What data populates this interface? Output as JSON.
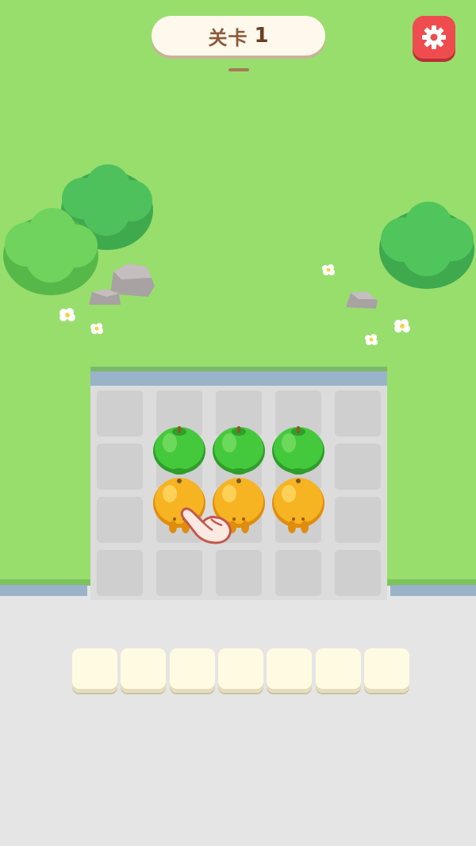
{
  "header": {
    "level_label": "关卡",
    "level_number": "1",
    "settings_icon": "gear-icon"
  },
  "board": {
    "columns": 5,
    "rows": 4,
    "pieces": [
      {
        "type": "green-apple",
        "col": 1,
        "row": 0
      },
      {
        "type": "green-apple",
        "col": 2,
        "row": 0
      },
      {
        "type": "green-apple",
        "col": 3,
        "row": 0
      },
      {
        "type": "orange",
        "col": 1,
        "row": 1
      },
      {
        "type": "orange",
        "col": 2,
        "row": 1
      },
      {
        "type": "orange",
        "col": 3,
        "row": 1
      }
    ],
    "hint": "pointing-hand-icon"
  },
  "tray": {
    "slot_count": 7,
    "slots": [
      "",
      "",
      "",
      "",
      "",
      "",
      ""
    ]
  },
  "colors": {
    "grass": "#98de6d",
    "board": "#dcdcdc",
    "settings_button": "#ee4c4f",
    "green_apple": "#3fbf3a",
    "orange": "#f3a81e"
  }
}
